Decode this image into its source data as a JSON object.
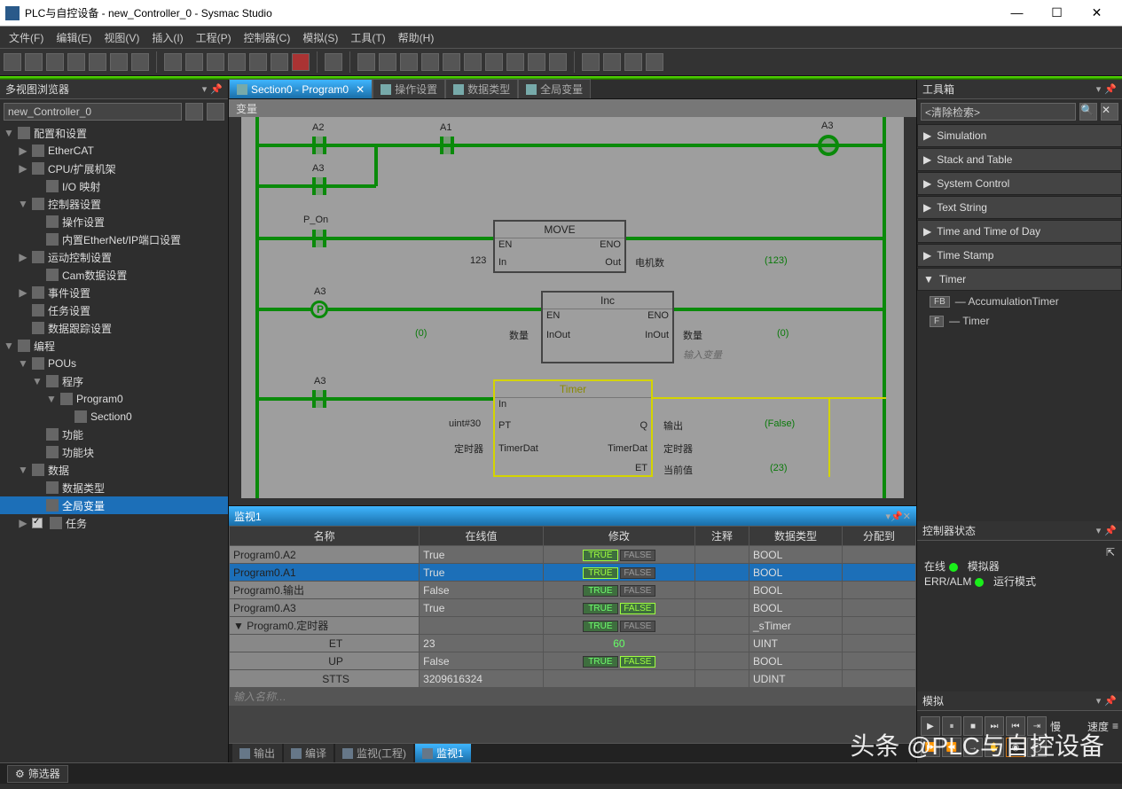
{
  "title": "PLC与自控设备 - new_Controller_0 - Sysmac Studio",
  "menu": [
    "文件(F)",
    "编辑(E)",
    "视图(V)",
    "插入(I)",
    "工程(P)",
    "控制器(C)",
    "模拟(S)",
    "工具(T)",
    "帮助(H)"
  ],
  "left_panel": {
    "title": "多视图浏览器",
    "controller": "new_Controller_0",
    "tree": [
      {
        "d": 0,
        "arr": "▼",
        "text": "配置和设置"
      },
      {
        "d": 1,
        "arr": "▶",
        "text": "EtherCAT"
      },
      {
        "d": 1,
        "arr": "▶",
        "text": "CPU/扩展机架"
      },
      {
        "d": 2,
        "arr": "",
        "text": "I/O 映射"
      },
      {
        "d": 1,
        "arr": "▼",
        "text": "控制器设置"
      },
      {
        "d": 2,
        "arr": "",
        "text": "操作设置"
      },
      {
        "d": 2,
        "arr": "",
        "text": "内置EtherNet/IP端口设置"
      },
      {
        "d": 1,
        "arr": "▶",
        "text": "运动控制设置"
      },
      {
        "d": 2,
        "arr": "",
        "text": "Cam数据设置"
      },
      {
        "d": 1,
        "arr": "▶",
        "text": "事件设置"
      },
      {
        "d": 1,
        "arr": "",
        "text": "任务设置"
      },
      {
        "d": 1,
        "arr": "",
        "text": "数据跟踪设置"
      },
      {
        "d": 0,
        "arr": "▼",
        "text": "编程"
      },
      {
        "d": 1,
        "arr": "▼",
        "text": "POUs"
      },
      {
        "d": 2,
        "arr": "▼",
        "text": "程序"
      },
      {
        "d": 3,
        "arr": "▼",
        "text": "Program0"
      },
      {
        "d": 4,
        "arr": "",
        "text": "Section0"
      },
      {
        "d": 2,
        "arr": "",
        "text": "功能"
      },
      {
        "d": 2,
        "arr": "",
        "text": "功能块"
      },
      {
        "d": 1,
        "arr": "▼",
        "text": "数据"
      },
      {
        "d": 2,
        "arr": "",
        "text": "数据类型"
      },
      {
        "d": 2,
        "arr": "",
        "text": "全局变量",
        "sel": true
      },
      {
        "d": 1,
        "arr": "▶",
        "text": "任务",
        "chk": true
      }
    ]
  },
  "tabs": [
    {
      "label": "Section0 - Program0",
      "active": true,
      "close": true
    },
    {
      "label": "操作设置"
    },
    {
      "label": "数据类型"
    },
    {
      "label": "全局变量"
    }
  ],
  "varband": "变量",
  "ladder": {
    "r1": {
      "a2": "A2",
      "a1": "A1",
      "a3": "A3",
      "a3b": "A3"
    },
    "r2": {
      "pon": "P_On",
      "fb": "MOVE",
      "en": "EN",
      "eno": "ENO",
      "in": "In",
      "out": "Out",
      "vin": "123",
      "vout": "电机数",
      "val": "(123)"
    },
    "r3": {
      "a3": "A3",
      "fb": "Inc",
      "en": "EN",
      "eno": "ENO",
      "io": "InOut",
      "io2": "InOut",
      "lv": "数量",
      "rv": "数量",
      "hint": "输入变量",
      "z1": "(0)",
      "z2": "(0)"
    },
    "r4": {
      "a3": "A3",
      "fb": "Timer",
      "in": "In",
      "pt": "PT",
      "q": "Q",
      "td1": "TimerDat",
      "td2": "TimerDat",
      "et": "ET",
      "v_pt": "uint#30",
      "v_td": "定时器",
      "v_q": "输出",
      "v_td2": "定时器",
      "v_et": "当前值",
      "qv": "(False)",
      "etv": "(23)"
    }
  },
  "watch": {
    "title": "监视1",
    "cols": [
      "名称",
      "在线值",
      "修改",
      "注释",
      "数据类型",
      "分配到"
    ],
    "rows": [
      {
        "name": "Program0.A2",
        "val": "True",
        "tf": "t",
        "type": "BOOL"
      },
      {
        "name": "Program0.A1",
        "val": "True",
        "tf": "t",
        "type": "BOOL",
        "sel": true
      },
      {
        "name": "Program0.输出",
        "val": "False",
        "tf": "",
        "type": "BOOL"
      },
      {
        "name": "Program0.A3",
        "val": "True",
        "tf": "f",
        "type": "BOOL"
      },
      {
        "name": "Program0.定时器",
        "val": "",
        "tf": "",
        "type": "_sTimer",
        "exp": true
      },
      {
        "name": "ET",
        "val": "23",
        "edit": "60",
        "type": "UINT",
        "sub": true
      },
      {
        "name": "UP",
        "val": "False",
        "tf": "f",
        "type": "BOOL",
        "sub": true
      },
      {
        "name": "STTS",
        "val": "3209616324",
        "type": "UDINT",
        "sub": true
      }
    ],
    "placeholder": "输入名称…",
    "true_label": "TRUE",
    "false_label": "FALSE"
  },
  "bottom_tabs": [
    "输出",
    "编译",
    "监视(工程)",
    "监视1"
  ],
  "toolbox": {
    "title": "工具箱",
    "search_ph": "<清除检索>",
    "items": [
      "Simulation",
      "Stack and Table",
      "System Control",
      "Text String",
      "Time and Time of Day",
      "Time Stamp",
      "Timer"
    ],
    "sub": [
      {
        "badge": "FB",
        "label": "AccumulationTimer"
      },
      {
        "badge": "F",
        "label": "Timer"
      }
    ]
  },
  "cstate": {
    "title": "控制器状态",
    "l1a": "在线",
    "l1b": "模拟器",
    "l2a": "ERR/ALM",
    "l2b": "运行模式"
  },
  "sim": {
    "title": "模拟",
    "slow": "慢",
    "speed": "速度"
  },
  "filter": "筛选器",
  "watermark": "头条 @PLC与自控设备"
}
